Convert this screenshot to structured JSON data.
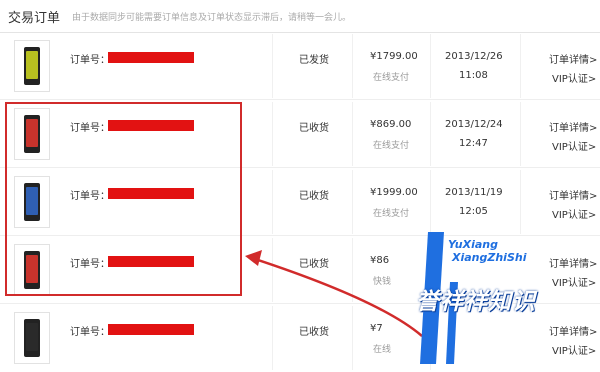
{
  "header": {
    "title": "交易订单",
    "notice": "由于数据同步可能需要订单信息及订单状态显示滞后，请稍等一会儿。"
  },
  "orders": [
    {
      "label": "订单号：",
      "status": "已发货",
      "price": "¥1799.00",
      "payment": "在线支付",
      "date": "2013/12/26",
      "time": "11:08",
      "detail": "订单详情>",
      "vip": "VIP认证>",
      "screen_color": "#b8c020"
    },
    {
      "label": "订单号：",
      "status": "已收货",
      "price": "¥869.00",
      "payment": "在线支付",
      "date": "2013/12/24",
      "time": "12:47",
      "detail": "订单详情>",
      "vip": "VIP认证>",
      "screen_color": "#c8332c"
    },
    {
      "label": "订单号：",
      "status": "已收货",
      "price": "¥1999.00",
      "payment": "在线支付",
      "date": "2013/11/19",
      "time": "12:05",
      "detail": "订单详情>",
      "vip": "VIP认证>",
      "screen_color": "#2f5fb3"
    },
    {
      "label": "订单号：",
      "status": "已收货",
      "price": "¥86",
      "payment": "快钱",
      "date": "",
      "time": "",
      "detail": "订单详情>",
      "vip": "VIP认证>",
      "screen_color": "#c8332c"
    },
    {
      "label": "订单号：",
      "status": "已收货",
      "price": "¥7",
      "payment": "在线",
      "date": "",
      "time": "",
      "detail": "订单详情>",
      "vip": "VIP认证>",
      "screen_color": "#2a2a2a"
    }
  ],
  "watermark": {
    "pinyin_line1": "YuXiang",
    "pinyin_line2": "XiangZhiShi",
    "chinese": "誉祥祥知识"
  },
  "colors": {
    "annotation_red": "#d12b2b",
    "redaction_red": "#e21212",
    "watermark_blue": "#1f6fe0"
  }
}
